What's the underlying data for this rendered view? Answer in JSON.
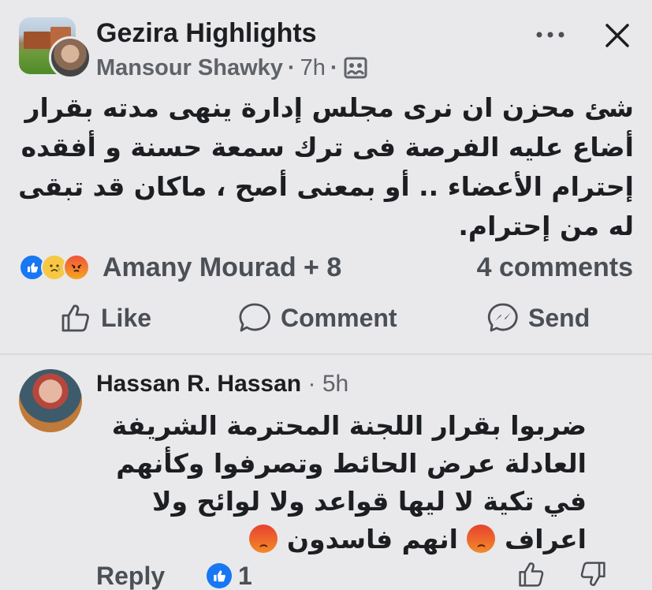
{
  "post": {
    "group_name": "Gezira Highlights",
    "author": "Mansour Shawky",
    "time": "7h",
    "text": "شئ محزن ان نرى مجلس إدارة ينهى مدته بقرار أضاع عليه الفرصة فى ترك سمعة حسنة و أفقده إحترام الأعضاء .. أو بمعنى أصح ، ماكان قد تبقى له من إحترام.",
    "reactions": [
      "like",
      "sad",
      "angry"
    ],
    "reactors": "Amany Mourad + 8",
    "comment_count": "4 comments"
  },
  "actions": {
    "like": "Like",
    "comment": "Comment",
    "send": "Send"
  },
  "comment": {
    "author": "Hassan R. Hassan",
    "time": "5h",
    "line1": "ضربوا بقرار اللجنة المحترمة الشريفة العادلة عرض الحائط وتصرفوا وكأنهم في تكية لا ليها قواعد ولا لوائح ولا اعراف",
    "line2": "انهم فاسدون",
    "reply_label": "Reply",
    "like_count": "1"
  },
  "colors": {
    "background": "#e9e9eb",
    "secondary_text": "#5f6369",
    "like_blue": "#1877f2"
  },
  "icons": [
    "more-icon",
    "close-icon",
    "group-icon",
    "like-icon",
    "comment-icon",
    "messenger-icon",
    "thumb-up-icon",
    "thumb-down-icon"
  ]
}
